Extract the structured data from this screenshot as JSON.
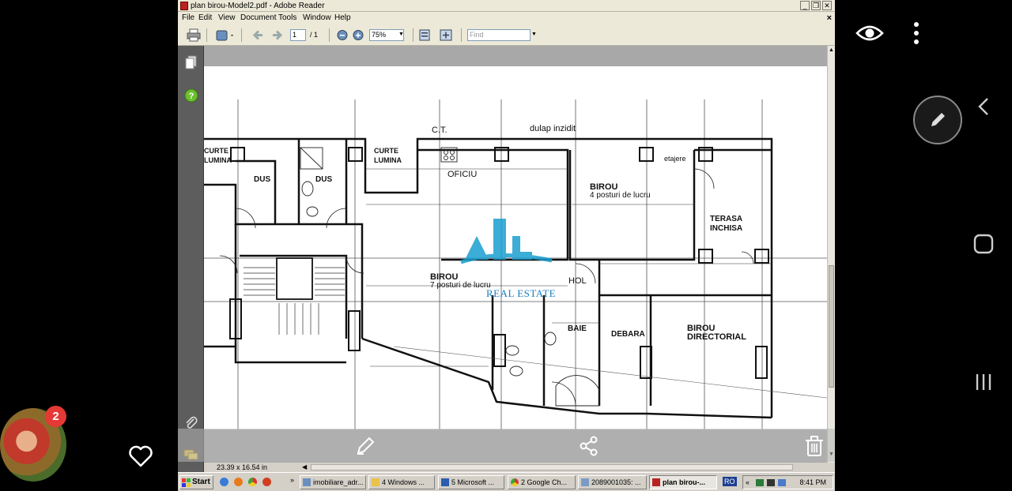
{
  "window": {
    "title": "plan birou-Model2.pdf - Adobe Reader",
    "controls": {
      "minimize": "_",
      "maximize": "❐",
      "close": "✕"
    }
  },
  "menu": {
    "items": [
      "File",
      "Edit",
      "View",
      "Document",
      "Tools",
      "Window",
      "Help"
    ],
    "close": "×"
  },
  "toolbar": {
    "page_current": "1",
    "page_total": "/ 1",
    "zoom": "75%",
    "find_placeholder": "Find"
  },
  "status": {
    "page_size": "23.39 x 16.54 in"
  },
  "floorplan": {
    "labels": {
      "ct": "C.T.",
      "dulap": "dulap inzidit",
      "curte_left_1": "CURTE",
      "curte_left_2": "LUMINA",
      "dus1": "DUS",
      "dus2": "DUS",
      "curte_mid_1": "CURTE",
      "curte_mid_2": "LUMINA",
      "oficiu": "OFICIU",
      "etajere": "etajere",
      "birou4_1": "BIROU",
      "birou4_2": "4 posturi de lucru",
      "terasa_1": "TERASA",
      "terasa_2": "INCHISA",
      "birou7_1": "BIROU",
      "birou7_2": "7 posturi de lucru",
      "hol": "HOL",
      "baie": "BAIE",
      "debara": "DEBARA",
      "director_1": "BIROU",
      "director_2": "DIRECTORIAL"
    }
  },
  "watermark": {
    "brand": "REAL ESTATE"
  },
  "taskbar": {
    "start": "Start",
    "tasks": [
      {
        "label": "imobiliare_adr...",
        "active": false
      },
      {
        "label": "4 Windows ...",
        "active": false
      },
      {
        "label": "5 Microsoft ...",
        "active": false
      },
      {
        "label": "2 Google Ch...",
        "active": false
      },
      {
        "label": "2089001035: ...",
        "active": false
      },
      {
        "label": "plan birou-...",
        "active": true
      }
    ],
    "lang": "RO",
    "time": "8:41 PM"
  },
  "gallery": {
    "notification_count": "2"
  },
  "colors": {
    "accent_blue": "#1a7fc0",
    "badge_red": "#e53935"
  }
}
